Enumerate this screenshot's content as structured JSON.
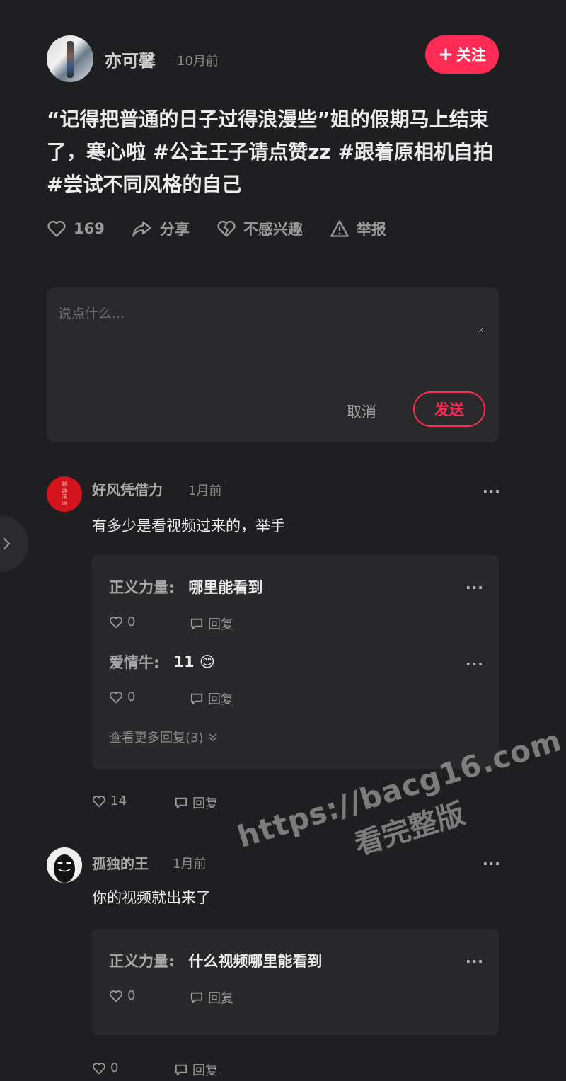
{
  "post": {
    "author": "亦可馨",
    "time": "10月前",
    "follow_label": "关注",
    "caption_line1": "“记得把普通的日子过得浪漫些”姐的假期马上结束",
    "caption_line2": "了，寒心啦 #公主王子请点赞zz #跟着原相机自拍",
    "caption_line3": "#尝试不同风格的自己",
    "actions": {
      "like_count": "169",
      "share_label": "分享",
      "not_interested_label": "不感兴趣",
      "report_label": "举报"
    }
  },
  "comment_box": {
    "placeholder": "说点什么...",
    "cancel_label": "取消",
    "send_label": "发送"
  },
  "comments": [
    {
      "name": "好风凭借力",
      "time": "1月前",
      "text": "有多少是看视频过来的，举手",
      "avatar_text": "财\n源\n滚\n滚",
      "more": "···",
      "like_count": "14",
      "reply_label": "回复",
      "replies": [
        {
          "name": "正义力量:",
          "text": "哪里能看到",
          "like_count": "0",
          "reply_label": "回复",
          "more": "···"
        },
        {
          "name": "爱情牛:",
          "text": "11 😊",
          "like_count": "0",
          "reply_label": "回复",
          "more": "···"
        }
      ],
      "view_more": "查看更多回复(3)"
    },
    {
      "name": "孤独的王",
      "time": "1月前",
      "text": "你的视频就出来了",
      "more": "···",
      "like_count": "0",
      "reply_label": "回复",
      "replies": [
        {
          "name": "正义力量:",
          "text": "什么视频哪里能看到",
          "like_count": "0",
          "reply_label": "回复",
          "more": "···"
        }
      ]
    }
  ],
  "watermark": {
    "url": "https://bacg16.com",
    "subtitle": "看完整版"
  },
  "colors": {
    "background": "#1f1f21",
    "accent": "#fe2c55",
    "panel": "#29292c"
  }
}
